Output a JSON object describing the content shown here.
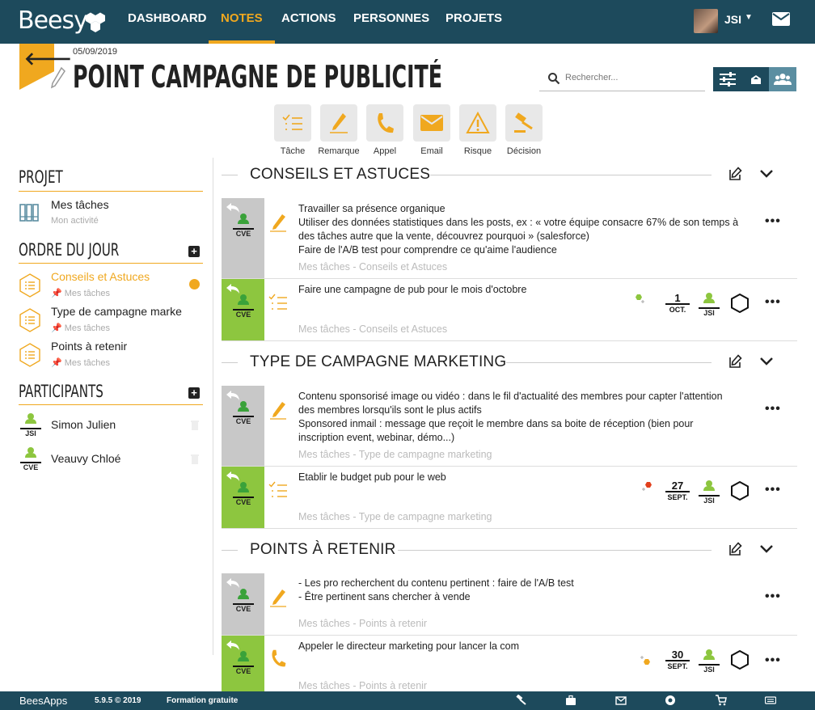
{
  "app": {
    "logo_text": "Beesy",
    "footer_logo_text": "BeesApps",
    "version": "5.9.5 © 2019",
    "training_link": "Formation gratuite"
  },
  "nav": {
    "items": [
      {
        "label": "DASHBOARD",
        "active": false
      },
      {
        "label": "NOTES",
        "active": true
      },
      {
        "label": "ACTIONS",
        "active": false
      },
      {
        "label": "PERSONNES",
        "active": false
      },
      {
        "label": "PROJETS",
        "active": false
      }
    ],
    "user": "JSI"
  },
  "header": {
    "date": "05/09/2019",
    "title": "POINT CAMPAGNE DE PUBLICITÉ",
    "search_placeholder": "Rechercher..."
  },
  "add_buttons": [
    {
      "label": "Tâche",
      "icon": "task-list-icon"
    },
    {
      "label": "Remarque",
      "icon": "pencil-icon"
    },
    {
      "label": "Appel",
      "icon": "phone-icon"
    },
    {
      "label": "Email",
      "icon": "envelope-icon"
    },
    {
      "label": "Risque",
      "icon": "warning-icon"
    },
    {
      "label": "Décision",
      "icon": "gavel-icon"
    }
  ],
  "sidebar": {
    "projet_heading": "PROJET",
    "project": {
      "name": "Mes tâches",
      "sub": "Mon activité"
    },
    "agenda_heading": "ORDRE DU JOUR",
    "agenda": [
      {
        "label": "Conseils et Astuces",
        "sub": "Mes tâches",
        "active": true
      },
      {
        "label": "Type de campagne marke",
        "sub": "Mes tâches",
        "active": false
      },
      {
        "label": "Points à retenir",
        "sub": "Mes tâches",
        "active": false
      }
    ],
    "participants_heading": "PARTICIPANTS",
    "participants": [
      {
        "name": "Simon Julien",
        "initials": "JSI"
      },
      {
        "name": "Veauvy Chloé",
        "initials": "CVE"
      }
    ]
  },
  "sections": [
    {
      "title": "CONSEILS ET ASTUCES",
      "cards": [
        {
          "author": "CVE",
          "type": "remark",
          "lines": [
            "Travailler sa présence organique",
            "Utiliser des données statistiques dans les posts, ex : « votre équipe consacre 67% de son temps à des tâches autre que la vente, découvrez pourquoi » (salesforce)",
            "Faire de l'A/B test pour comprendre ce qu'aime l'audience"
          ],
          "meta": "Mes tâches - Conseils et Astuces"
        },
        {
          "author": "CVE",
          "type": "task",
          "lines": [
            "Faire une campagne de pub pour le mois d'octobre"
          ],
          "meta": "Mes tâches - Conseils et Astuces",
          "priority_color": "#8dc63f",
          "due": {
            "day": "1",
            "month": "OCT."
          },
          "assignee": "JSI"
        }
      ]
    },
    {
      "title": "TYPE DE CAMPAGNE MARKETING",
      "cards": [
        {
          "author": "CVE",
          "type": "remark",
          "lines": [
            "Contenu sponsorisé image ou vidéo : dans le fil d'actualité des membres pour capter l'attention des membres lorsqu'ils sont le plus actifs",
            "Sponsored inmail : message que reçoit le membre dans sa boite de réception (bien pour inscription event, webinar, démo...)"
          ],
          "meta": "Mes tâches - Type de campagne marketing"
        },
        {
          "author": "CVE",
          "type": "task",
          "lines": [
            "Etablir le budget pub pour le web"
          ],
          "meta": "Mes tâches - Type de campagne marketing",
          "priority_color": "#e2401c",
          "due": {
            "day": "27",
            "month": "SEPT."
          },
          "assignee": "JSI"
        }
      ]
    },
    {
      "title": "POINTS À RETENIR",
      "cards": [
        {
          "author": "CVE",
          "type": "remark",
          "lines": [
            "- Les pro recherchent du contenu pertinent : faire de l'A/B test",
            "- Être pertinent sans chercher à vende"
          ],
          "meta": "Mes tâches - Points à retenir"
        },
        {
          "author": "CVE",
          "type": "call",
          "lines": [
            "Appeler le directeur marketing pour lancer la com"
          ],
          "meta": "Mes tâches - Points à retenir",
          "priority_color": "#f0a81f",
          "due": {
            "day": "30",
            "month": "SEPT."
          },
          "assignee": "JSI"
        }
      ]
    }
  ],
  "colors": {
    "navbar": "#1d4a5c",
    "accent": "#f0a81f",
    "green": "#8dc63f",
    "grey": "#c8c8c8"
  }
}
